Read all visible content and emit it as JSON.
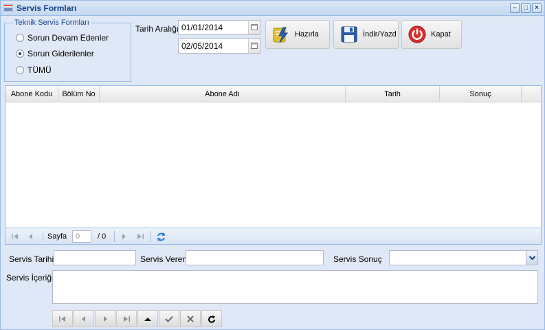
{
  "window": {
    "title": "Servis Formları"
  },
  "filter": {
    "legend": "Teknik Servis Formları",
    "options": [
      {
        "label": "Sorun Devam Edenler",
        "checked": false
      },
      {
        "label": "Sorun Giderilenler",
        "checked": true
      },
      {
        "label": "TÜMÜ",
        "checked": false
      }
    ]
  },
  "date_range": {
    "label": "Tarih Aralığı",
    "start": "01/01/2014",
    "end": "02/05/2014"
  },
  "toolbar": {
    "prepare_label": "Hazırla",
    "download_label": "İndir/Yazd",
    "close_label": "Kapat"
  },
  "grid": {
    "columns": [
      "Abone Kodu",
      "Bölüm No",
      "Abone Adı",
      "Tarih",
      "Sonuç"
    ],
    "rows": []
  },
  "pager": {
    "page_label": "Sayfa",
    "page_value": "0",
    "total_label": "/ 0"
  },
  "form": {
    "service_date_label": "Servis Tarihi",
    "service_by_label": "Servis Veren",
    "service_result_label": "Servis Sonuç",
    "service_content_label": "Servis İçeriği",
    "service_date_value": "",
    "service_by_value": "",
    "service_result_value": "",
    "service_content_value": ""
  },
  "colors": {
    "border": "#99bbe8",
    "title": "#15428b",
    "background": "#dfe8f6"
  }
}
